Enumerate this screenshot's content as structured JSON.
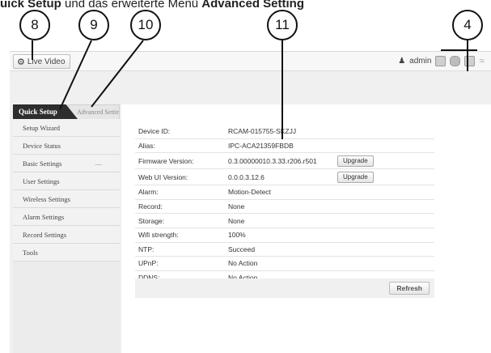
{
  "caption": {
    "lead": "uick Setup",
    "middle": " und das erweiterte Menü ",
    "tail": "Advanced Setting"
  },
  "callouts": [
    "8",
    "9",
    "10",
    "11",
    "4"
  ],
  "topbar": {
    "live_video_label": "Live Video",
    "user_label": "admin"
  },
  "tabs": {
    "quick_setup": "Quick Setup",
    "advanced_settings": "Advanced Settings"
  },
  "sidebar": {
    "items": [
      {
        "label": "Setup Wizard"
      },
      {
        "label": "Device Status"
      },
      {
        "label": "Basic Settings",
        "marker": "—"
      },
      {
        "label": "User Settings"
      },
      {
        "label": "Wireless Settings"
      },
      {
        "label": "Alarm Settings"
      },
      {
        "label": "Record Settings"
      },
      {
        "label": "Tools"
      }
    ]
  },
  "device_info": {
    "rows": [
      {
        "label": "Device ID:",
        "value": "RCAM-015755-SKZJJ"
      },
      {
        "label": "Alias:",
        "value": "IPC-ACA21359FBDB"
      },
      {
        "label": "Firmware Version:",
        "value": "0.3.00000010.3.33.r206.r501",
        "button": "Upgrade"
      },
      {
        "label": "Web UI Version:",
        "value": "0.0.0.3.12.6",
        "button": "Upgrade"
      },
      {
        "label": "Alarm:",
        "value": "Motion-Detect"
      },
      {
        "label": "Record:",
        "value": "None"
      },
      {
        "label": "Storage:",
        "value": "None"
      },
      {
        "label": "Wifi strength:",
        "value": "100%"
      },
      {
        "label": "NTP:",
        "value": "Succeed"
      },
      {
        "label": "UPnP:",
        "value": "No Action"
      },
      {
        "label": "DDNS:",
        "value": "No Action"
      }
    ],
    "refresh_label": "Refresh"
  }
}
